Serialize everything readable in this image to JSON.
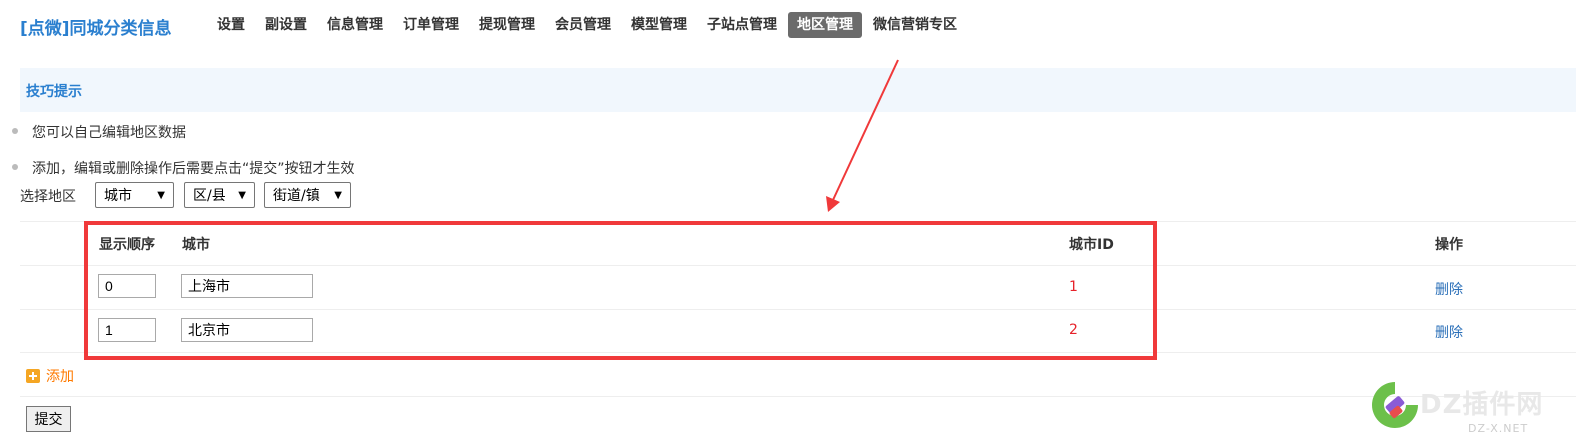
{
  "brand": "[点微]同城分类信息",
  "nav": {
    "items": [
      "设置",
      "副设置",
      "信息管理",
      "订单管理",
      "提现管理",
      "会员管理",
      "模型管理",
      "子站点管理",
      "地区管理",
      "微信营销专区"
    ],
    "active_index": 8
  },
  "tips": {
    "title": "技巧提示",
    "lines": [
      "您可以自己编辑地区数据",
      "添加，编辑或删除操作后需要点击“提交”按钮才生效"
    ]
  },
  "region": {
    "label": "选择地区",
    "selects": [
      "城市",
      "区/县",
      "街道/镇"
    ]
  },
  "table": {
    "headers": {
      "order": "显示顺序",
      "city": "城市",
      "city_id": "城市ID",
      "action": "操作"
    },
    "rows": [
      {
        "order": "0",
        "city": "上海市",
        "city_id": "1",
        "action": "删除"
      },
      {
        "order": "1",
        "city": "北京市",
        "city_id": "2",
        "action": "删除"
      }
    ]
  },
  "add_label": "添加",
  "submit_label": "提交",
  "watermark": {
    "text": "DZ插件网",
    "sub": "DZ-X.NET"
  },
  "colors": {
    "brand": "#2a7fcf",
    "active_nav": "#6b6b6b",
    "annotation": "#f0393a",
    "city_id": "#e6222a",
    "link": "#2a6fb8",
    "add": "#ff7a00"
  }
}
